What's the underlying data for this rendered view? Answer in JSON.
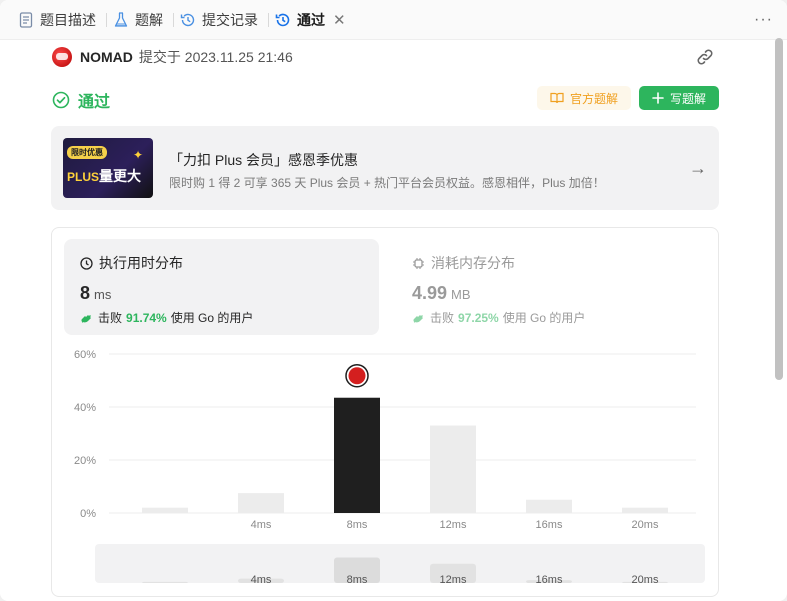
{
  "tabs": [
    {
      "label": "题目描述",
      "icon": "document-icon"
    },
    {
      "label": "题解",
      "icon": "flask-icon"
    },
    {
      "label": "提交记录",
      "icon": "history-icon"
    },
    {
      "label": "通过",
      "icon": "history-icon",
      "active": true,
      "closable": true,
      "close_glyph": "✕"
    }
  ],
  "more_glyph": "···",
  "submission": {
    "username": "NOMAD",
    "submitted_at": "提交于 2023.11.25 21:46",
    "status": "通过"
  },
  "buttons": {
    "official_solution": "官方题解",
    "write_solution": "写题解"
  },
  "promo": {
    "badge": "限时优惠",
    "image_text": "PLUS量更大",
    "image_plus": "PLUS",
    "image_rest": "量更大",
    "title": "「力扣 Plus 会员」感恩季优惠",
    "subtitle": "限时购 1 得 2 可享 365 天 Plus 会员 + 热门平台会员权益。感恩相伴，Plus 加倍！",
    "arrow": "→"
  },
  "stats": {
    "runtime": {
      "label": "执行用时分布",
      "value": "8",
      "unit": "ms",
      "beat_prefix": "击败",
      "beat_pct": "91.74%",
      "beat_suffix": "使用 Go 的用户"
    },
    "memory": {
      "label": "消耗内存分布",
      "value": "4.99",
      "unit": "MB",
      "beat_prefix": "击败",
      "beat_pct": "97.25%",
      "beat_suffix": "使用 Go 的用户"
    }
  },
  "colors": {
    "accent_green": "#2db55d",
    "orange": "#f0a020",
    "highlight_bar": "#1f1f1f",
    "bar": "#ececec"
  },
  "chart_data": {
    "type": "bar",
    "y_ticks": [
      "60%",
      "40%",
      "20%",
      "0%"
    ],
    "ylim": [
      0,
      60
    ],
    "x_tick_labels": [
      "4ms",
      "8ms",
      "12ms",
      "16ms",
      "20ms"
    ],
    "bars": [
      {
        "x": 0,
        "value": 2.0,
        "highlight": false
      },
      {
        "x": 4,
        "value": 7.5,
        "highlight": false
      },
      {
        "x": 8,
        "value": 43.5,
        "highlight": true
      },
      {
        "x": 12,
        "value": 33.0,
        "highlight": false
      },
      {
        "x": 16,
        "value": 5.0,
        "highlight": false
      },
      {
        "x": 20,
        "value": 2.0,
        "highlight": false
      }
    ],
    "overview_tick_labels": [
      "4ms",
      "8ms",
      "12ms",
      "16ms",
      "20ms"
    ],
    "grid": true
  }
}
